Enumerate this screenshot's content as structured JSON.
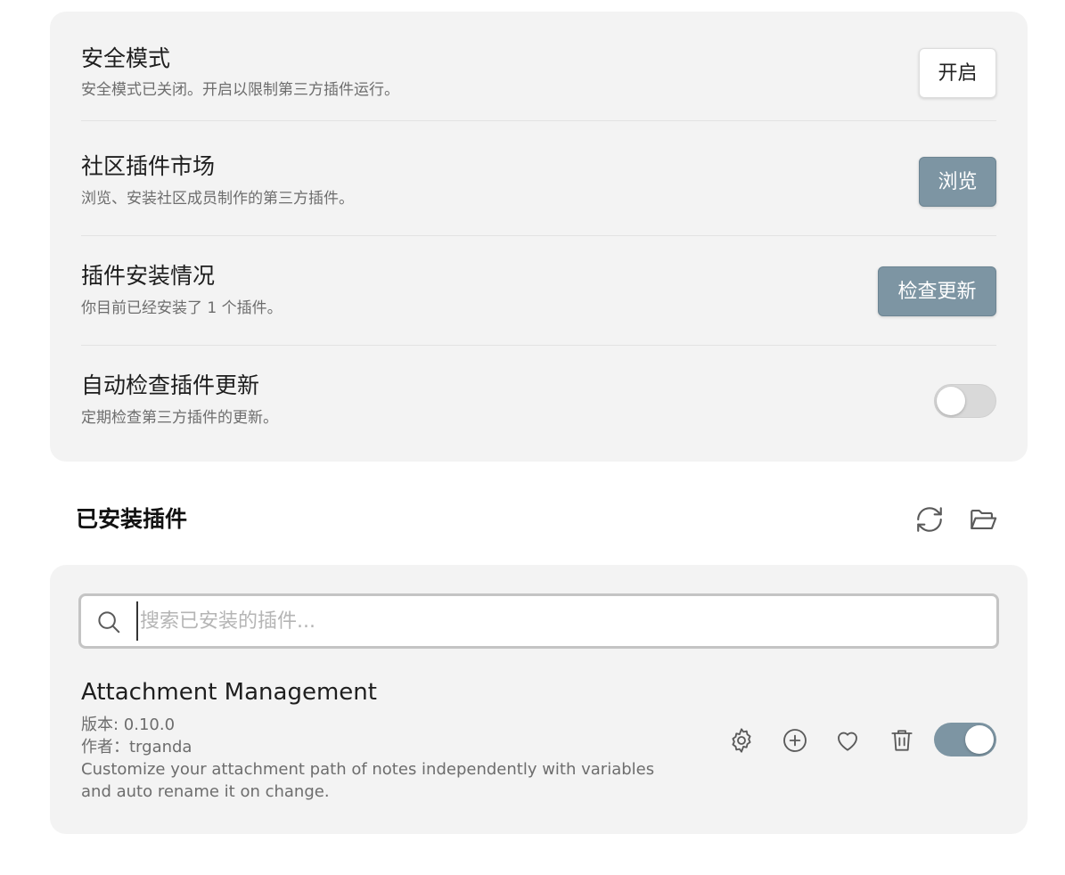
{
  "settings": [
    {
      "title": "安全模式",
      "description": "安全模式已关闭。开启以限制第三方插件运行。",
      "control": "button",
      "button_label": "开启"
    },
    {
      "title": "社区插件市场",
      "description": "浏览、安装社区成员制作的第三方插件。",
      "control": "button",
      "button_label": "浏览"
    },
    {
      "title": "插件安装情况",
      "description": "你目前已经安装了 1 个插件。",
      "control": "button",
      "button_label": "检查更新"
    },
    {
      "title": "自动检查插件更新",
      "description": "定期检查第三方插件的更新。",
      "control": "toggle",
      "toggle_state": "off"
    }
  ],
  "installed": {
    "heading": "已安装插件",
    "header_icons": [
      "refresh-icon",
      "folder-open-icon"
    ],
    "search": {
      "placeholder": "搜索已安装的插件...",
      "value": ""
    },
    "plugins": [
      {
        "name": "Attachment Management",
        "version": "版本: 0.10.0",
        "author": "作者：trganda",
        "description_line1": "Customize your attachment path of notes independently with variables",
        "description_line2": "and auto rename it on change.",
        "action_icons": [
          "gear-icon",
          "plus-circle-icon",
          "heart-icon",
          "trash-icon"
        ],
        "enabled": true
      }
    ]
  },
  "colors": {
    "accent": "#7d95a3",
    "card_background": "#f3f3f3",
    "muted_text": "#6d6d6d"
  }
}
